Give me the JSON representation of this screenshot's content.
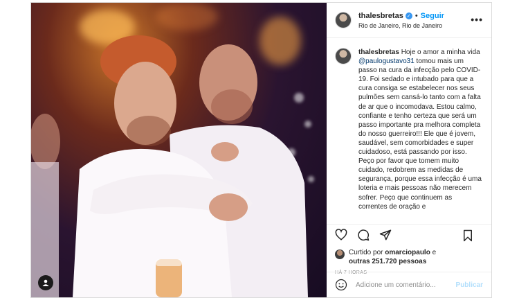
{
  "post": {
    "username": "thalesbretas",
    "follow_label": "Seguir",
    "separator": "•",
    "location": "Rio de Janeiro, Rio de Janeiro",
    "more_label": "•••",
    "caption_mention": "@paulogustavo31",
    "caption_before": "Hoje o amor a minha vida ",
    "caption_after": " tomou mais um passo na cura da infecção pelo COVID-19. Foi sedado e intubado para que a cura consiga se estabelecer nos seus pulmões sem cansá-lo tanto com a falta de ar que o incomodava. Estou calmo, confiante e tenho certeza que será um passo importante pra melhora completa do nosso guerreiro!!! Ele que é jovem, saudável, sem comorbidades e super cuidadoso, está passando por isso. Peço por favor que tomem muito cuidado, redobrem as medidas de segurança, porque essa infecção é uma loteria e mais pessoas não merecem sofrer. Peço que continuem as correntes de oração e"
  },
  "likes": {
    "prefix": "Curtido por",
    "liker": "omarciopaulo",
    "joiner": "e",
    "others": "outras 251.720 pessoas"
  },
  "time_ago": "HÁ 7 HORAS",
  "comment": {
    "placeholder": "Adicione um comentário...",
    "publish_label": "Publicar"
  },
  "colors": {
    "accent": "#0095f6",
    "verified": "#3897f0",
    "publish_disabled": "#b2dffc"
  }
}
